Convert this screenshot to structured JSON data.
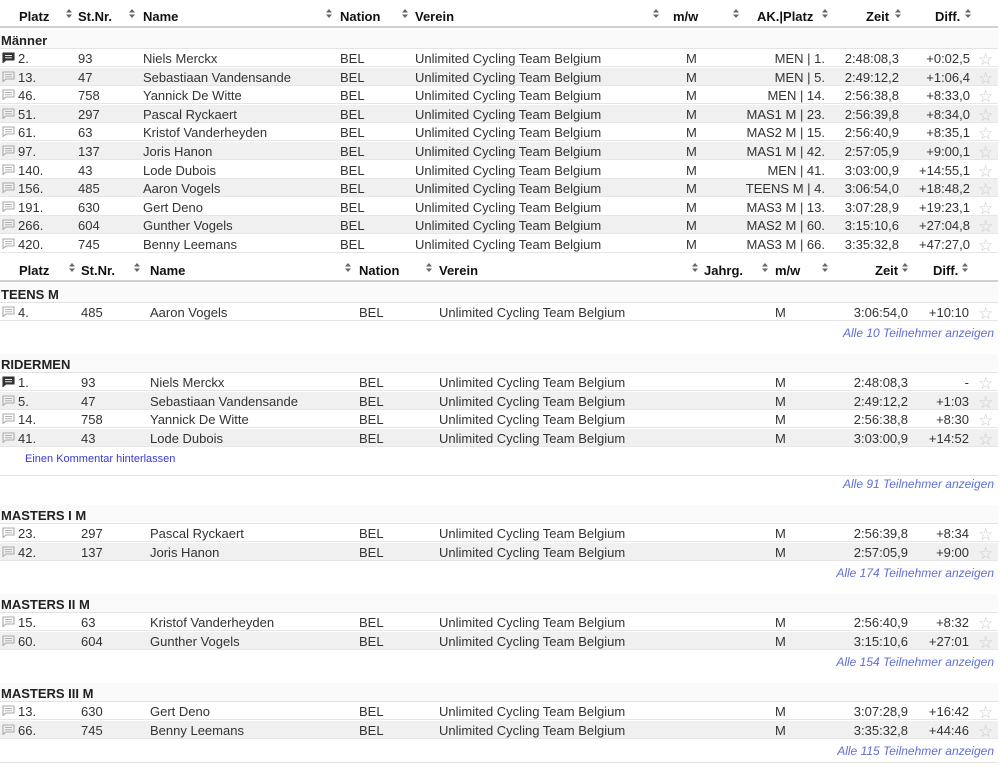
{
  "table1": {
    "headers": {
      "platz": "Platz",
      "stnr": "St.Nr.",
      "name": "Name",
      "nation": "Nation",
      "verein": "Verein",
      "mw": "m/w",
      "ak": "AK.|Platz",
      "zeit": "Zeit",
      "diff": "Diff."
    },
    "section": "Männer",
    "rows": [
      {
        "platz": "2.",
        "stnr": "93",
        "name": "Niels Merckx",
        "nation": "BEL",
        "verein": "Unlimited Cycling Team Belgium",
        "mw": "M",
        "ak": "MEN | 1.",
        "zeit": "2:48:08,3",
        "diff": "+0:02,5",
        "comment_active": true
      },
      {
        "platz": "13.",
        "stnr": "47",
        "name": "Sebastiaan Vandensande",
        "nation": "BEL",
        "verein": "Unlimited Cycling Team Belgium",
        "mw": "M",
        "ak": "MEN | 5.",
        "zeit": "2:49:12,2",
        "diff": "+1:06,4",
        "comment_active": false
      },
      {
        "platz": "46.",
        "stnr": "758",
        "name": "Yannick De Witte",
        "nation": "BEL",
        "verein": "Unlimited Cycling Team Belgium",
        "mw": "M",
        "ak": "MEN | 14.",
        "zeit": "2:56:38,8",
        "diff": "+8:33,0",
        "comment_active": false
      },
      {
        "platz": "51.",
        "stnr": "297",
        "name": "Pascal Ryckaert",
        "nation": "BEL",
        "verein": "Unlimited Cycling Team Belgium",
        "mw": "M",
        "ak": "MAS1 M | 23.",
        "zeit": "2:56:39,8",
        "diff": "+8:34,0",
        "comment_active": false
      },
      {
        "platz": "61.",
        "stnr": "63",
        "name": "Kristof Vanderheyden",
        "nation": "BEL",
        "verein": "Unlimited Cycling Team Belgium",
        "mw": "M",
        "ak": "MAS2 M | 15.",
        "zeit": "2:56:40,9",
        "diff": "+8:35,1",
        "comment_active": false
      },
      {
        "platz": "97.",
        "stnr": "137",
        "name": "Joris Hanon",
        "nation": "BEL",
        "verein": "Unlimited Cycling Team Belgium",
        "mw": "M",
        "ak": "MAS1 M | 42.",
        "zeit": "2:57:05,9",
        "diff": "+9:00,1",
        "comment_active": false
      },
      {
        "platz": "140.",
        "stnr": "43",
        "name": "Lode Dubois",
        "nation": "BEL",
        "verein": "Unlimited Cycling Team Belgium",
        "mw": "M",
        "ak": "MEN | 41.",
        "zeit": "3:03:00,9",
        "diff": "+14:55,1",
        "comment_active": false
      },
      {
        "platz": "156.",
        "stnr": "485",
        "name": "Aaron Vogels",
        "nation": "BEL",
        "verein": "Unlimited Cycling Team Belgium",
        "mw": "M",
        "ak": "TEENS M | 4.",
        "zeit": "3:06:54,0",
        "diff": "+18:48,2",
        "comment_active": false
      },
      {
        "platz": "191.",
        "stnr": "630",
        "name": "Gert Deno",
        "nation": "BEL",
        "verein": "Unlimited Cycling Team Belgium",
        "mw": "M",
        "ak": "MAS3 M | 13.",
        "zeit": "3:07:28,9",
        "diff": "+19:23,1",
        "comment_active": false
      },
      {
        "platz": "266.",
        "stnr": "604",
        "name": "Gunther Vogels",
        "nation": "BEL",
        "verein": "Unlimited Cycling Team Belgium",
        "mw": "M",
        "ak": "MAS2 M | 60.",
        "zeit": "3:15:10,6",
        "diff": "+27:04,8",
        "comment_active": false
      },
      {
        "platz": "420.",
        "stnr": "745",
        "name": "Benny Leemans",
        "nation": "BEL",
        "verein": "Unlimited Cycling Team Belgium",
        "mw": "M",
        "ak": "MAS3 M | 66.",
        "zeit": "3:35:32,8",
        "diff": "+47:27,0",
        "comment_active": false
      }
    ]
  },
  "table2": {
    "headers": {
      "platz": "Platz",
      "stnr": "St.Nr.",
      "name": "Name",
      "nation": "Nation",
      "verein": "Verein",
      "jahrg": "Jahrg.",
      "mw": "m/w",
      "zeit": "Zeit",
      "diff": "Diff."
    },
    "groups": [
      {
        "title": "TEENS M",
        "more": "Alle 10 Teilnehmer anzeigen",
        "comment_link": "",
        "rows": [
          {
            "platz": "4.",
            "stnr": "485",
            "name": "Aaron Vogels",
            "nation": "BEL",
            "verein": "Unlimited Cycling Team Belgium",
            "mw": "M",
            "zeit": "3:06:54,0",
            "diff": "+10:10",
            "comment_active": false
          }
        ]
      },
      {
        "title": "RIDERMEN",
        "more": "Alle 91 Teilnehmer anzeigen",
        "comment_link": "Einen Kommentar hinterlassen",
        "rows": [
          {
            "platz": "1.",
            "stnr": "93",
            "name": "Niels Merckx",
            "nation": "BEL",
            "verein": "Unlimited Cycling Team Belgium",
            "mw": "M",
            "zeit": "2:48:08,3",
            "diff": "-",
            "comment_active": true
          },
          {
            "platz": "5.",
            "stnr": "47",
            "name": "Sebastiaan Vandensande",
            "nation": "BEL",
            "verein": "Unlimited Cycling Team Belgium",
            "mw": "M",
            "zeit": "2:49:12,2",
            "diff": "+1:03",
            "comment_active": false
          },
          {
            "platz": "14.",
            "stnr": "758",
            "name": "Yannick De Witte",
            "nation": "BEL",
            "verein": "Unlimited Cycling Team Belgium",
            "mw": "M",
            "zeit": "2:56:38,8",
            "diff": "+8:30",
            "comment_active": false
          },
          {
            "platz": "41.",
            "stnr": "43",
            "name": "Lode Dubois",
            "nation": "BEL",
            "verein": "Unlimited Cycling Team Belgium",
            "mw": "M",
            "zeit": "3:03:00,9",
            "diff": "+14:52",
            "comment_active": false
          }
        ]
      },
      {
        "title": "MASTERS I M",
        "more": "Alle 174 Teilnehmer anzeigen",
        "comment_link": "",
        "rows": [
          {
            "platz": "23.",
            "stnr": "297",
            "name": "Pascal Ryckaert",
            "nation": "BEL",
            "verein": "Unlimited Cycling Team Belgium",
            "mw": "M",
            "zeit": "2:56:39,8",
            "diff": "+8:34",
            "comment_active": false
          },
          {
            "platz": "42.",
            "stnr": "137",
            "name": "Joris Hanon",
            "nation": "BEL",
            "verein": "Unlimited Cycling Team Belgium",
            "mw": "M",
            "zeit": "2:57:05,9",
            "diff": "+9:00",
            "comment_active": false
          }
        ]
      },
      {
        "title": "MASTERS II M",
        "more": "Alle 154 Teilnehmer anzeigen",
        "comment_link": "",
        "rows": [
          {
            "platz": "15.",
            "stnr": "63",
            "name": "Kristof Vanderheyden",
            "nation": "BEL",
            "verein": "Unlimited Cycling Team Belgium",
            "mw": "M",
            "zeit": "2:56:40,9",
            "diff": "+8:32",
            "comment_active": false
          },
          {
            "platz": "60.",
            "stnr": "604",
            "name": "Gunther Vogels",
            "nation": "BEL",
            "verein": "Unlimited Cycling Team Belgium",
            "mw": "M",
            "zeit": "3:15:10,6",
            "diff": "+27:01",
            "comment_active": false
          }
        ]
      },
      {
        "title": "MASTERS III M",
        "more": "Alle 115 Teilnehmer anzeigen",
        "comment_link": "",
        "rows": [
          {
            "platz": "13.",
            "stnr": "630",
            "name": "Gert Deno",
            "nation": "BEL",
            "verein": "Unlimited Cycling Team Belgium",
            "mw": "M",
            "zeit": "3:07:28,9",
            "diff": "+16:42",
            "comment_active": false
          },
          {
            "platz": "66.",
            "stnr": "745",
            "name": "Benny Leemans",
            "nation": "BEL",
            "verein": "Unlimited Cycling Team Belgium",
            "mw": "M",
            "zeit": "3:35:32,8",
            "diff": "+44:46",
            "comment_active": false
          }
        ]
      }
    ]
  },
  "icons": {
    "comment": "comment-icon",
    "star": "star-icon",
    "sort": "sort-icon"
  },
  "colors": {
    "link": "#5f6fd6",
    "comment_link": "#3a3ad0",
    "row_alt": "#f0f0f0"
  }
}
